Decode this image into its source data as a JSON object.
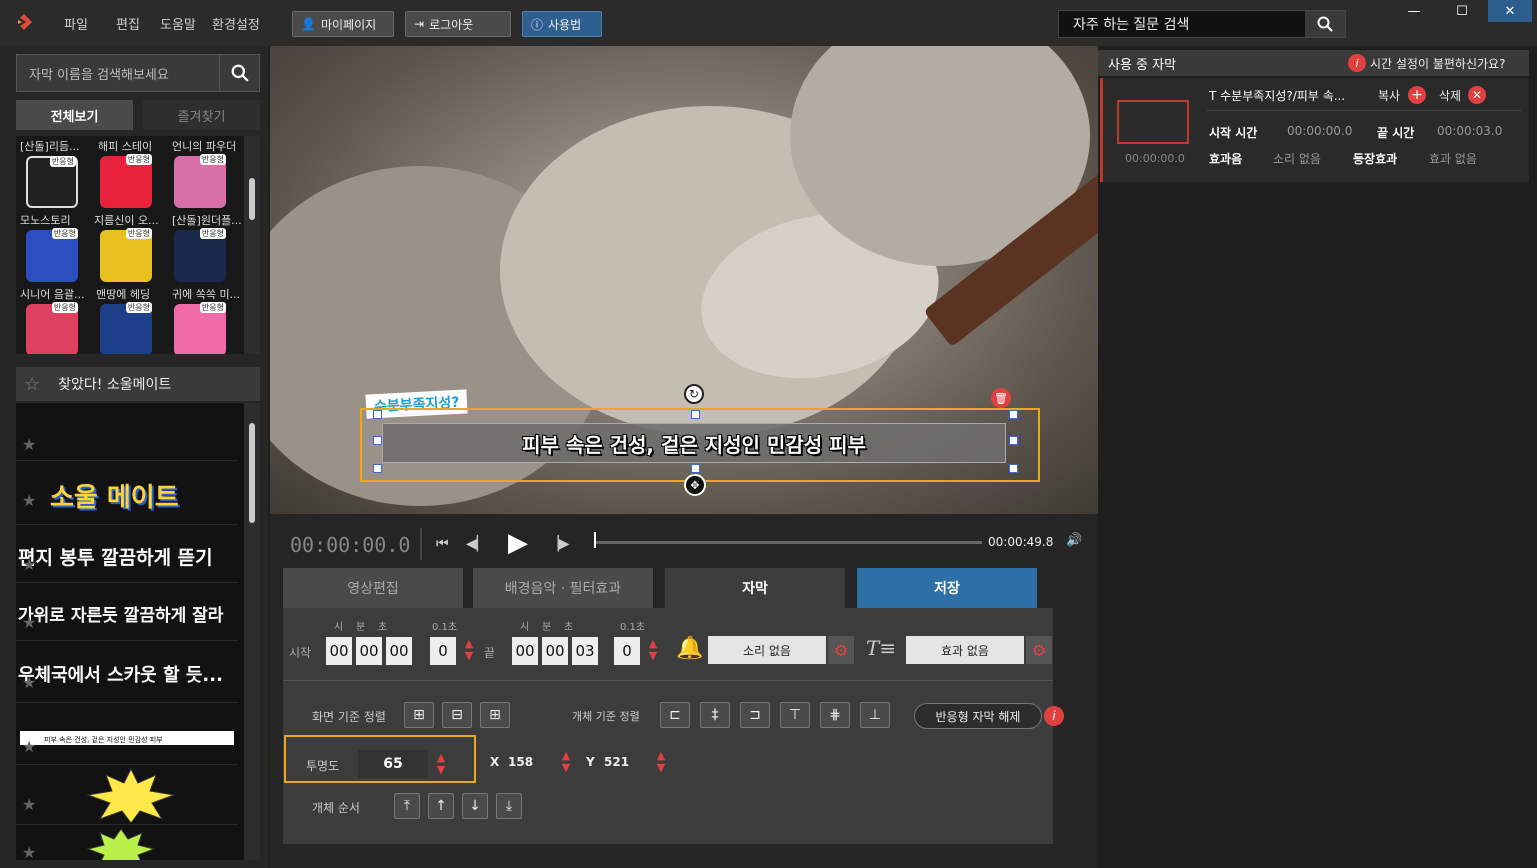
{
  "menu": {
    "file": "파일",
    "edit": "편집",
    "help": "도움말",
    "settings": "환경설정"
  },
  "top_buttons": {
    "mypage": "마이페이지",
    "logout": "로그아웃",
    "howto": "사용법"
  },
  "faq": {
    "label": "자주 하는 질문 검색"
  },
  "window": {
    "minimize": "—",
    "maximize": "☐",
    "close": "✕"
  },
  "sidebar": {
    "search_placeholder": "자막 이름을 검색해보세요",
    "tabs": {
      "all": "전체보기",
      "favorites": "즐겨찾기"
    },
    "grid_labels": [
      "[산돌]리듬...",
      "해피 스테이",
      "언니의 파우더",
      "모노스토리",
      "지름신이 오...",
      "[산돌]원더플...",
      "시니어 음괄...",
      "맨땅에 헤딩",
      "귀에 쏙쏙 미..."
    ],
    "badge": "반응형",
    "category": "찾았다! 소울메이트",
    "templates": [
      "소울 메이트",
      "편지 봉투 깔끔하게 뜯기",
      "가위로 자른듯 깔끔하게 잘라",
      "우체국에서 스카웃 할 듯...",
      "피부 속은 건성, 겉은 지성인 민감성 피부"
    ]
  },
  "video": {
    "subtitle_main": "피부 속은 건성, 겉은 지성인 민감성 피부",
    "subtitle_tag": "수분부족지성?"
  },
  "player": {
    "current_time": "00:00:00.0",
    "end_time": "00:00:49.8"
  },
  "tabs": {
    "video_edit": "영상편집",
    "bgm_filter": "배경음악 · 필터효과",
    "subtitle": "자막",
    "save": "저장"
  },
  "time_fields": {
    "h": "시",
    "m": "분",
    "s": "초",
    "tenth": "0.1초",
    "start_label": "시작",
    "end_label": "끝",
    "start": [
      "00",
      "00",
      "00",
      "0"
    ],
    "end": [
      "00",
      "00",
      "03",
      "0"
    ]
  },
  "sound": {
    "value": "소리 없음"
  },
  "effect": {
    "value": "효과 없음"
  },
  "align": {
    "screen_label": "화면 기준 정렬",
    "object_label": "개체 기준 정렬",
    "responsive_release": "반응형 자막 해제"
  },
  "opacity": {
    "label": "투명도",
    "value": "65"
  },
  "position": {
    "x_label": "X",
    "x": "158",
    "y_label": "Y",
    "y": "521"
  },
  "order": {
    "label": "개체 순서"
  },
  "right_panel": {
    "title": "사용 중 자막",
    "help": "시간 설정이 불편하신가요?",
    "item_title": "T 수분부족지성?/피부 속...",
    "copy": "복사",
    "delete": "삭제",
    "start_label": "시작 시간",
    "start": "00:00:00.0",
    "end_label": "끝 시간",
    "end": "00:00:03.0",
    "sound_label": "효과음",
    "sound": "소리 없음",
    "appear_label": "등장효과",
    "appear": "효과 없음",
    "thumb_time": "00:00:00.0"
  },
  "colors": {
    "accent": "#e8a820",
    "save_tab": "#2f6fa8",
    "red": "#e04040"
  }
}
